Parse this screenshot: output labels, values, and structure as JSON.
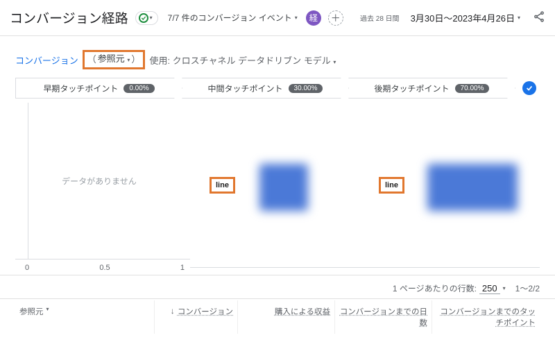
{
  "header": {
    "title": "コンバージョン経路",
    "events_count": "7/7 件のコンバージョン イベント",
    "econ_badge": "経",
    "date_small": "過去 28 日間",
    "date_range": "3月30日〜2023年4月26日"
  },
  "controls": {
    "conversion": "コンバージョン",
    "dim_label": "参照元",
    "uses": "使用: クロスチャネル データドリブン モデル"
  },
  "touchpoints": [
    {
      "label": "早期タッチポイント",
      "pct": "0.00%"
    },
    {
      "label": "中間タッチポイント",
      "pct": "30.00%"
    },
    {
      "label": "後期タッチポイント",
      "pct": "70.00%"
    }
  ],
  "chart_data": [
    {
      "type": "bar",
      "title": "早期タッチポイント",
      "nodata_message": "データがありません",
      "xticks": [
        "0",
        "0.5",
        "1"
      ],
      "series": []
    },
    {
      "type": "bar",
      "title": "中間タッチポイント",
      "series": [
        {
          "name": "line",
          "value": 30.0
        }
      ]
    },
    {
      "type": "bar",
      "title": "後期タッチポイント",
      "series": [
        {
          "name": "line",
          "value": 70.0
        }
      ]
    }
  ],
  "table_controls": {
    "rows_label": "1 ページあたりの行数:",
    "rows_value": "250",
    "range": "1〜2/2"
  },
  "table_headers": {
    "col0": "参照元",
    "col1": "コンバージョン",
    "col2": "購入による収益",
    "col3": "コンバージョンまでの日数",
    "col4": "コンバージョンまでのタッチポイント"
  }
}
